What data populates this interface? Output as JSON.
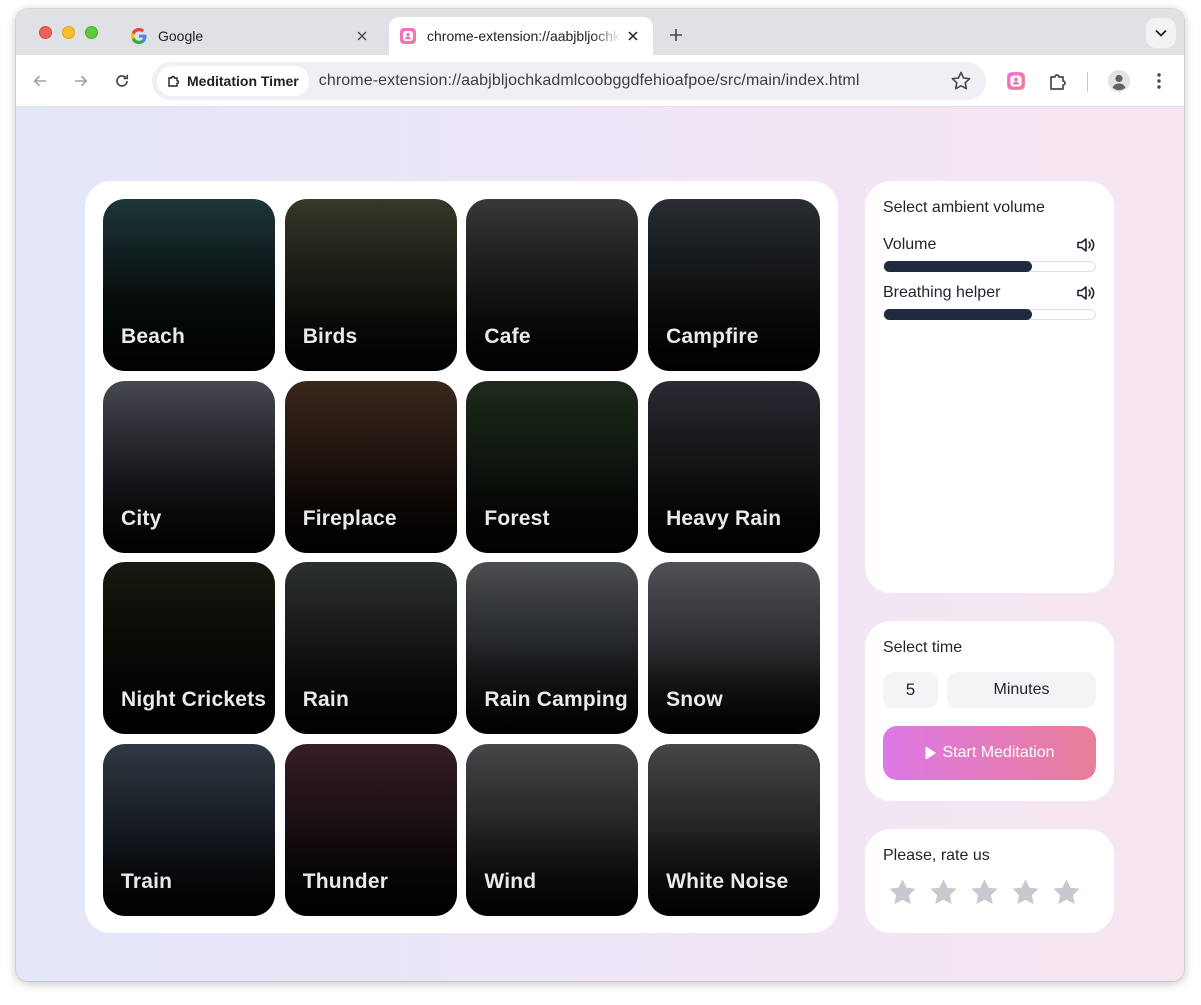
{
  "browser": {
    "tabs": [
      {
        "title": "Google",
        "favicon": "google-g-icon",
        "active": false
      },
      {
        "title": "chrome-extension://aabjbljochkadmlcoobggdfehioafpoe/src/main/index.html",
        "favicon": "meditation-extension-icon",
        "active": true
      }
    ],
    "site_chip": "Meditation Timer",
    "url": "chrome-extension://aabjbljochkadmlcoobggdfehioafpoe/src/main/index.html"
  },
  "sounds": [
    {
      "label": "Beach",
      "colors": [
        "#1f3a3c",
        "#0d1717",
        "#04080a"
      ]
    },
    {
      "label": "Birds",
      "colors": [
        "#3b3a2c",
        "#1d2218",
        "#070807"
      ]
    },
    {
      "label": "Cafe",
      "colors": [
        "#3b3b3c",
        "#1e1d1c",
        "#070707"
      ]
    },
    {
      "label": "Campfire",
      "colors": [
        "#2b3034",
        "#15181a",
        "#050606"
      ]
    },
    {
      "label": "City",
      "colors": [
        "#4b4d55",
        "#24262c",
        "#08080a"
      ]
    },
    {
      "label": "Fireplace",
      "colors": [
        "#3e2a1e",
        "#24160f",
        "#080504"
      ]
    },
    {
      "label": "Forest",
      "colors": [
        "#1f2d1d",
        "#121b11",
        "#040604"
      ]
    },
    {
      "label": "Heavy Rain",
      "colors": [
        "#2d2c36",
        "#18191a",
        "#050506"
      ]
    },
    {
      "label": "Night Crickets",
      "colors": [
        "#1a1a12",
        "#0c0c08",
        "#030303"
      ]
    },
    {
      "label": "Rain",
      "colors": [
        "#2f3431",
        "#181b19",
        "#050605"
      ]
    },
    {
      "label": "Rain Camping",
      "colors": [
        "#505356",
        "#2c3036",
        "#0a0b0c"
      ]
    },
    {
      "label": "Snow",
      "colors": [
        "#55565a",
        "#3a3b40",
        "#0b0b0d"
      ]
    },
    {
      "label": "Train",
      "colors": [
        "#333c48",
        "#1c222a",
        "#06070a"
      ]
    },
    {
      "label": "Thunder",
      "colors": [
        "#3a1e28",
        "#1d1218",
        "#060405"
      ]
    },
    {
      "label": "Wind",
      "colors": [
        "#4a4b4e",
        "#2d2e31",
        "#0a0a0b"
      ]
    },
    {
      "label": "White Noise",
      "colors": [
        "#4a4a4c",
        "#2f2f31",
        "#0b0b0c"
      ]
    }
  ],
  "volume_panel": {
    "title": "Select ambient volume",
    "sliders": [
      {
        "label": "Volume",
        "icon": "speaker-icon",
        "level": 0.7
      },
      {
        "label": "Breathing helper",
        "icon": "speaker-icon",
        "level": 0.7
      }
    ]
  },
  "time_panel": {
    "title": "Select time",
    "value": "5",
    "unit": "Minutes",
    "start_label": "Start Meditation"
  },
  "rating_panel": {
    "title": "Please, rate us",
    "stars_total": 5,
    "stars_filled": 0
  },
  "colors": {
    "accent_gradient_start": "#de78e6",
    "accent_gradient_end": "#e97e98",
    "slider_fill": "#1f2a3f",
    "star_empty": "#c6c9cf"
  }
}
